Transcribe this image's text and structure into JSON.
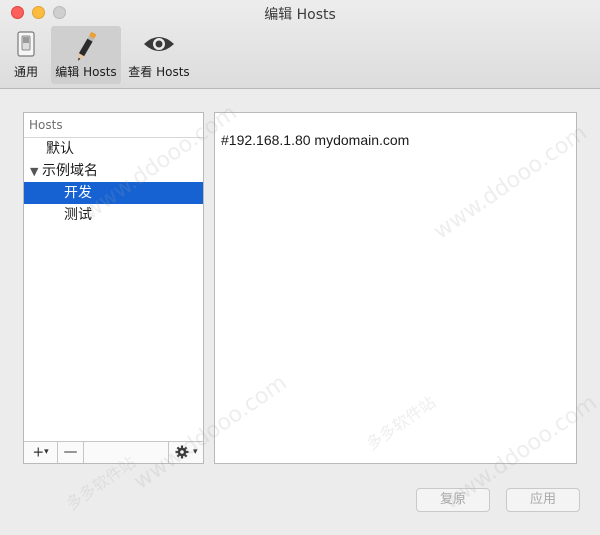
{
  "window": {
    "title": "编辑 Hosts"
  },
  "toolbar": {
    "items": [
      {
        "label": "通用",
        "icon": "switch-icon"
      },
      {
        "label": "编辑 Hosts",
        "icon": "pencil-icon"
      },
      {
        "label": "查看 Hosts",
        "icon": "eye-icon"
      }
    ]
  },
  "sidebar": {
    "header": "Hosts",
    "items": [
      {
        "label": "默认"
      },
      {
        "label": "示例域名"
      },
      {
        "label": "开发"
      },
      {
        "label": "测试"
      }
    ],
    "add": "+",
    "remove": "—"
  },
  "editor": {
    "content": "#192.168.1.80 mydomain.com"
  },
  "buttons": {
    "revert": "复原",
    "apply": "应用"
  },
  "watermark": {
    "text": "www.ddooo.com",
    "brand": "多多软件站"
  },
  "colors": {
    "selection": "#1662d2",
    "close": "#fc605c",
    "minimize": "#fdbc40"
  }
}
